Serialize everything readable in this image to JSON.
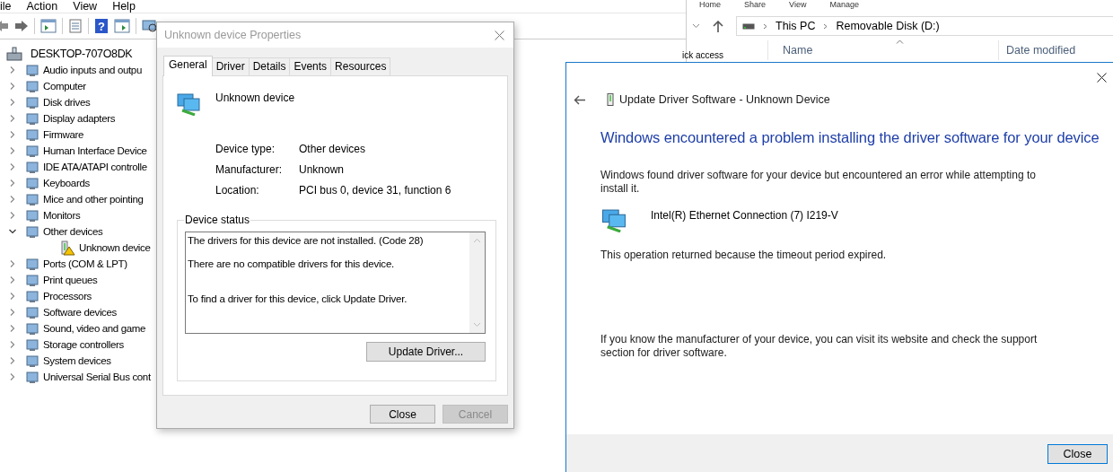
{
  "device_manager": {
    "menu": [
      "ile",
      "Action",
      "View",
      "Help"
    ],
    "help_glyph": "?",
    "tree": {
      "label": "DESKTOP-707O8DK",
      "children": [
        {
          "label": "Audio inputs and outpu",
          "expanded": false
        },
        {
          "label": "Computer",
          "expanded": false
        },
        {
          "label": "Disk drives",
          "expanded": false
        },
        {
          "label": "Display adapters",
          "expanded": false
        },
        {
          "label": "Firmware",
          "expanded": false
        },
        {
          "label": "Human Interface Device",
          "expanded": false
        },
        {
          "label": "IDE ATA/ATAPI controlle",
          "expanded": false
        },
        {
          "label": "Keyboards",
          "expanded": false
        },
        {
          "label": "Mice and other pointing",
          "expanded": false
        },
        {
          "label": "Monitors",
          "expanded": false
        },
        {
          "label": "Other devices",
          "expanded": true,
          "children": [
            {
              "label": "Unknown device",
              "warning": true
            }
          ]
        },
        {
          "label": "Ports (COM & LPT)",
          "expanded": false
        },
        {
          "label": "Print queues",
          "expanded": false
        },
        {
          "label": "Processors",
          "expanded": false
        },
        {
          "label": "Software devices",
          "expanded": false
        },
        {
          "label": "Sound, video and game",
          "expanded": false
        },
        {
          "label": "Storage controllers",
          "expanded": false
        },
        {
          "label": "System devices",
          "expanded": false
        },
        {
          "label": "Universal Serial Bus cont",
          "expanded": false
        }
      ]
    }
  },
  "explorer": {
    "ribbon_tabs": [
      "Home",
      "Share",
      "View",
      "Manage"
    ],
    "breadcrumb": [
      "This PC",
      "Removable Disk (D:)"
    ],
    "nav_item": "ick access",
    "columns": [
      "Name",
      "Date modified"
    ]
  },
  "properties_dialog": {
    "title": "Unknown device Properties",
    "active": false,
    "tabs": [
      {
        "label": "General",
        "selected": true
      },
      {
        "label": "Driver",
        "selected": false
      },
      {
        "label": "Details",
        "selected": false
      },
      {
        "label": "Events",
        "selected": false
      },
      {
        "label": "Resources",
        "selected": false
      }
    ],
    "device_name": "Unknown device",
    "fields": [
      {
        "label": "Device type:",
        "value": "Other devices"
      },
      {
        "label": "Manufacturer:",
        "value": "Unknown"
      },
      {
        "label": "Location:",
        "value": "PCI bus 0, device 31, function 6"
      }
    ],
    "status_group": "Device status",
    "status_lines": [
      "The drivers for this device are not installed. (Code 28)",
      "There are no compatible drivers for this device.",
      "To find a driver for this device, click Update Driver."
    ],
    "update_button": "Update Driver...",
    "buttons": [
      {
        "label": "Close",
        "disabled": false
      },
      {
        "label": "Cancel",
        "disabled": true
      }
    ]
  },
  "update_dialog": {
    "title": "Update Driver Software - Unknown Device",
    "heading": "Windows encountered a problem installing the driver software for your device",
    "message": "Windows found driver software for your device but encountered an error while attempting to install it.",
    "device": "Intel(R) Ethernet Connection (7) I219-V",
    "reason": "This operation returned because the timeout period expired.",
    "help": "If you know the manufacturer of your device, you can visit its website and check the support section for driver software.",
    "button": "Close"
  }
}
